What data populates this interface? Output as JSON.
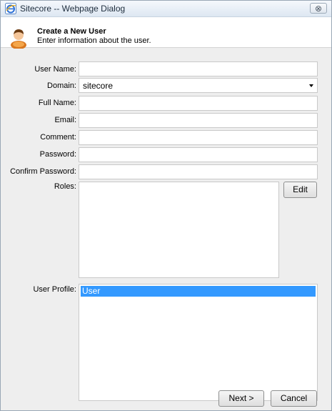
{
  "window": {
    "title": "Sitecore -- Webpage Dialog",
    "close_glyph": "⊗",
    "close_icon": "close-icon"
  },
  "header": {
    "title": "Create a New User",
    "subtitle": "Enter information about the user."
  },
  "form": {
    "user_name": {
      "label": "User Name:",
      "value": ""
    },
    "domain": {
      "label": "Domain:",
      "value": "sitecore"
    },
    "full_name": {
      "label": "Full Name:",
      "value": ""
    },
    "email": {
      "label": "Email:",
      "value": ""
    },
    "comment": {
      "label": "Comment:",
      "value": ""
    },
    "password": {
      "label": "Password:",
      "value": ""
    },
    "confirm_password": {
      "label": "Confirm Password:",
      "value": ""
    },
    "roles": {
      "label": "Roles:",
      "items": []
    },
    "user_profile": {
      "label": "User Profile:",
      "items": [
        "User"
      ],
      "selected": "User"
    }
  },
  "buttons": {
    "edit": "Edit",
    "next": "Next >",
    "cancel": "Cancel"
  },
  "colors": {
    "selection": "#3399ff",
    "dialog_bg": "#eeeeee"
  }
}
